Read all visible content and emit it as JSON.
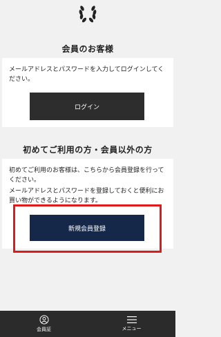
{
  "member": {
    "title": "会員のお客様",
    "description": "メールアドレスとパスワードを入力してログインしてください。",
    "login_label": "ログイン"
  },
  "first_time": {
    "title": "初めてご利用の方・会員以外の方",
    "line1": "初めてご利用のお客様は、こちらから会員登録を行ってください。",
    "line2": "メールアドレスとパスワードを登録しておくと便利にお買い物ができるようになります。",
    "register_label": "新規会員登録"
  },
  "bottom_nav": {
    "items": [
      {
        "label": "会員証",
        "icon": "user-circle-icon"
      },
      {
        "label": "メニュー",
        "icon": "hamburger-menu-icon"
      }
    ]
  },
  "colors": {
    "background": "#f1f1f1",
    "login_button": "#2d2d2d",
    "register_button": "#16284a",
    "highlight": "#e01a1a",
    "bottom_bar": "#2b2b2b"
  }
}
